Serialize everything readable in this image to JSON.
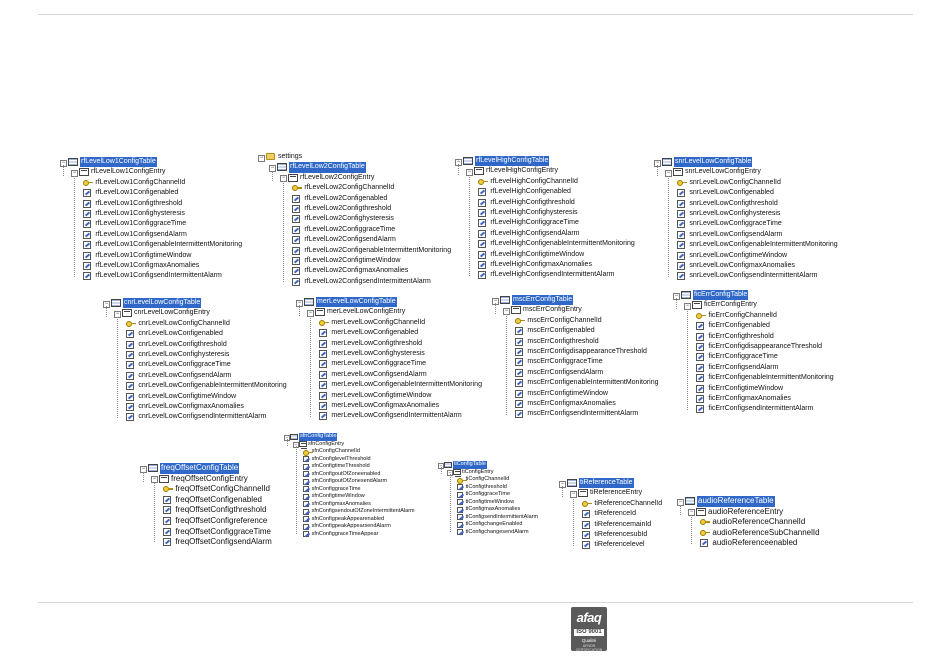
{
  "trees": [
    {
      "id": "rflevellow1",
      "table": "rfLevelLow1ConfigTable",
      "entry": "rfLevelLow1ConfigEntry",
      "key_columns": [
        "rfLevelLow1ConfigChannelId"
      ],
      "columns": [
        "rfLevelLow1Configenabled",
        "rfLevelLow1Configthreshold",
        "rfLevelLow1Confighysteresis",
        "rfLevelLow1ConfiggraceTime",
        "rfLevelLow1ConfigsendAlarm",
        "rfLevelLow1ConfigenableIntermittentMonitoring",
        "rfLevelLow1ConfigtimeWindow",
        "rfLevelLow1ConfigmaxAnomalies",
        "rfLevelLow1ConfigsendIntermittentAlarm"
      ]
    },
    {
      "id": "rflevellow2",
      "folder": "settings",
      "table": "rfLevelLow2ConfigTable",
      "entry": "rfLevelLow2ConfigEntry",
      "key_columns": [
        "rfLevelLow2ConfigChannelId"
      ],
      "columns": [
        "rfLevelLow2Configenabled",
        "rfLevelLow2Configthreshold",
        "rfLevelLow2Confighysteresis",
        "rfLevelLow2ConfiggraceTime",
        "rfLevelLow2ConfigsendAlarm",
        "rfLevelLow2ConfigenableIntermittentMonitoring",
        "rfLevelLow2ConfigtimeWindow",
        "rfLevelLow2ConfigmaxAnomalies",
        "rfLevelLow2ConfigsendIntermittentAlarm"
      ]
    },
    {
      "id": "rflevelhigh",
      "table": "rfLevelHighConfigTable",
      "entry": "rfLevelHighConfigEntry",
      "key_columns": [
        "rfLevelHighConfigChannelId"
      ],
      "columns": [
        "rfLevelHighConfigenabled",
        "rfLevelHighConfigthreshold",
        "rfLevelHighConfighysteresis",
        "rfLevelHighConfiggraceTime",
        "rfLevelHighConfigsendAlarm",
        "rfLevelHighConfigenableIntermittentMonitoring",
        "rfLevelHighConfigtimeWindow",
        "rfLevelHighConfigmaxAnomalies",
        "rfLevelHighConfigsendIntermittentAlarm"
      ]
    },
    {
      "id": "snrlevellow",
      "table": "snrLevelLowConfigTable",
      "entry": "snrLevelLowConfigEntry",
      "key_columns": [
        "snrLevelLowConfigChannelId"
      ],
      "columns": [
        "snrLevelLowConfigenabled",
        "snrLevelLowConfigthreshold",
        "snrLevelLowConfighysteresis",
        "snrLevelLowConfiggraceTime",
        "snrLevelLowConfigsendAlarm",
        "snrLevelLowConfigenableIntermittentMonitoring",
        "snrLevelLowConfigtimeWindow",
        "snrLevelLowConfigmaxAnomalies",
        "snrLevelLowConfigsendIntermittentAlarm"
      ]
    },
    {
      "id": "cnrlevellow",
      "table": "cnrLevelLowConfigTable",
      "entry": "cnrLevelLowConfigEntry",
      "key_columns": [
        "cnrLevelLowConfigChannelId"
      ],
      "columns": [
        "cnrLevelLowConfigenabled",
        "cnrLevelLowConfigthreshold",
        "cnrLevelLowConfighysteresis",
        "cnrLevelLowConfiggraceTime",
        "cnrLevelLowConfigsendAlarm",
        "cnrLevelLowConfigenableIntermittentMonitoring",
        "cnrLevelLowConfigtimeWindow",
        "cnrLevelLowConfigmaxAnomalies",
        "cnrLevelLowConfigsendIntermittentAlarm"
      ]
    },
    {
      "id": "merlevellow",
      "table": "merLevelLowConfigTable",
      "entry": "merLevelLowConfigEntry",
      "key_columns": [
        "merLevelLowConfigChannelId"
      ],
      "columns": [
        "merLevelLowConfigenabled",
        "merLevelLowConfigthreshold",
        "merLevelLowConfighysteresis",
        "merLevelLowConfiggraceTime",
        "merLevelLowConfigsendAlarm",
        "merLevelLowConfigenableIntermittentMonitoring",
        "merLevelLowConfigtimeWindow",
        "merLevelLowConfigmaxAnomalies",
        "merLevelLowConfigsendIntermittentAlarm"
      ]
    },
    {
      "id": "mscerr",
      "table": "mscErrConfigTable",
      "entry": "mscErrConfigEntry",
      "key_columns": [
        "mscErrConfigChannelId"
      ],
      "columns": [
        "mscErrConfigenabled",
        "mscErrConfigthreshold",
        "mscErrConfigdisappearanceThreshold",
        "mscErrConfiggraceTime",
        "mscErrConfigsendAlarm",
        "mscErrConfigenableIntermittentMonitoring",
        "mscErrConfigtimeWindow",
        "mscErrConfigmaxAnomalies",
        "mscErrConfigsendIntermittentAlarm"
      ]
    },
    {
      "id": "ficerr",
      "table": "ficErrConfigTable",
      "entry": "ficErrConfigEntry",
      "key_columns": [
        "ficErrConfigChannelId"
      ],
      "columns": [
        "ficErrConfigenabled",
        "ficErrConfigthreshold",
        "ficErrConfigdisappearanceThreshold",
        "ficErrConfiggraceTime",
        "ficErrConfigsendAlarm",
        "ficErrConfigenableIntermittentMonitoring",
        "ficErrConfigtimeWindow",
        "ficErrConfigmaxAnomalies",
        "ficErrConfigsendIntermittentAlarm"
      ]
    },
    {
      "id": "freqoffset",
      "table": "freqOffsetConfigTable",
      "entry": "freqOffsetConfigEntry",
      "key_columns": [
        "freqOffsetConfigChannelId"
      ],
      "columns": [
        "freqOffsetConfigenabled",
        "freqOffsetConfigthreshold",
        "freqOffsetConfigreference",
        "freqOffsetConfiggraceTime",
        "freqOffsetConfigsendAlarm"
      ]
    },
    {
      "id": "sfn",
      "table": "sfnConfigTable",
      "entry": "sfnConfigEntry",
      "key_columns": [
        "sfnConfigChannelId"
      ],
      "columns": [
        "sfnConfiglevelThreshold",
        "sfnConfigtimeThreshold",
        "sfnConfigoutOfZoneenabled",
        "sfnConfigoutOfZonesendAlarm",
        "sfnConfiggraceTime",
        "sfnConfigtimeWindow",
        "sfnConfigmaxAnomalies",
        "sfnConfigsendoutOfZoneIntermittentAlarm",
        "sfnConfigpeakAppearenabled",
        "sfnConfigpeakAppearsendAlarm",
        "sfnConfiggraceTimeAppear"
      ]
    },
    {
      "id": "ti",
      "table": "tiConfigTable",
      "entry": "tiConfigEntry",
      "key_columns": [
        "tiConfigChannelId"
      ],
      "columns": [
        "tiConfigthreshold",
        "tiConfiggraceTime",
        "tiConfigtimeWindow",
        "tiConfigmaxAnomalies",
        "tiConfigsendIntermittentAlarm",
        "tiConfigchangeEnabled",
        "tiConfigchangesendAlarm"
      ]
    },
    {
      "id": "tireference",
      "table": "tiReferenceTable",
      "entry": "tiReferenceEntry",
      "key_columns": [
        "tiReferenceChannelId"
      ],
      "columns": [
        "tiReferenceId",
        "tiReferencemainId",
        "tiReferencesubId",
        "tiReferencelevel"
      ]
    },
    {
      "id": "audioreference",
      "table": "audioReferenceTable",
      "entry": "audioReferenceEntry",
      "key_columns": [
        "audioReferenceChannelId",
        "audioReferenceSubChannelId"
      ],
      "columns": [
        "audioReferenceenabled"
      ]
    }
  ],
  "logo": {
    "name": "afaq",
    "certification": "ISO 9001",
    "quality": "Qualité",
    "caption": "AFNOR CERTIFICATION"
  },
  "colors": {
    "selection": "#2f68c8",
    "key_icon": "#f3cc3a",
    "folder_icon": "#f0cd62"
  }
}
